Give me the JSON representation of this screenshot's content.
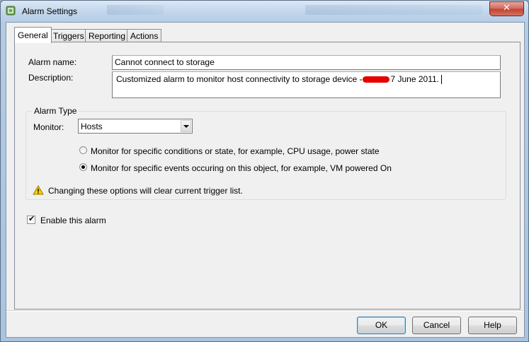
{
  "window": {
    "title": "Alarm Settings",
    "close_glyph": "✕"
  },
  "tabs": [
    {
      "label": "General",
      "active": true
    },
    {
      "label": "Triggers",
      "active": false
    },
    {
      "label": "Reporting",
      "active": false
    },
    {
      "label": "Actions",
      "active": false
    }
  ],
  "general": {
    "alarm_name_label": "Alarm name:",
    "alarm_name_value": "Cannot connect to storage",
    "description_label": "Description:",
    "description_value_prefix": "Customized alarm to monitor host connectivity to storage device -",
    "description_value_suffix": "7 June 2011.",
    "alarm_type_legend": "Alarm Type",
    "monitor_label": "Monitor:",
    "monitor_value": "Hosts",
    "radio_conditions_label": "Monitor for specific conditions or state, for example, CPU usage, power state",
    "radio_conditions_selected": false,
    "radio_events_label": "Monitor for specific events occuring on this object, for example, VM powered On",
    "radio_events_selected": true,
    "warning_text": "Changing these options will clear current trigger list.",
    "enable_label": "Enable this alarm",
    "enable_checked": true
  },
  "buttons": {
    "ok": "OK",
    "cancel": "Cancel",
    "help": "Help"
  },
  "icons": {
    "app": "vsphere-icon",
    "warning": "warning-icon",
    "check": "✔"
  },
  "colors": {
    "redaction": "#e60000",
    "close_button": "#c24132"
  }
}
